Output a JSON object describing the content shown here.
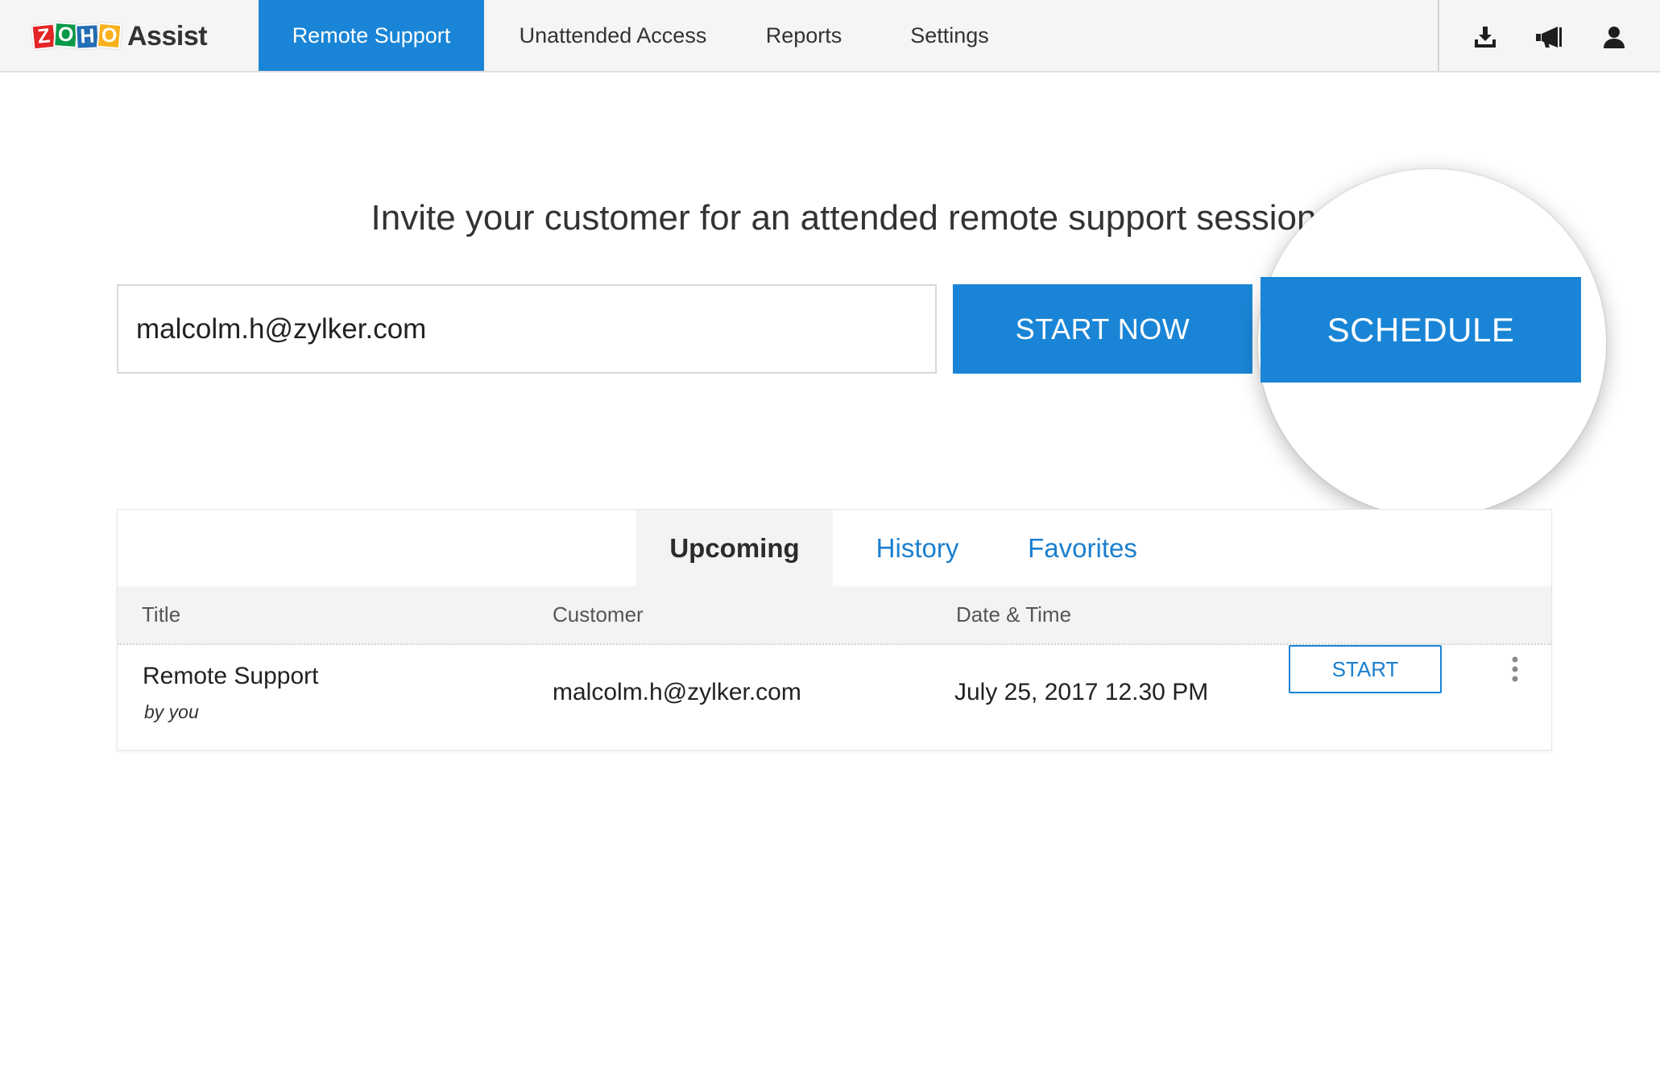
{
  "app": {
    "logo_letters": [
      "Z",
      "O",
      "H",
      "O"
    ],
    "logo_colors": [
      "#e42527",
      "#089949",
      "#226db4",
      "#f9b21d"
    ],
    "product_name": "Assist"
  },
  "nav": {
    "items": [
      {
        "label": "Remote Support",
        "active": true
      },
      {
        "label": "Unattended Access",
        "active": false
      },
      {
        "label": "Reports",
        "active": false
      },
      {
        "label": "Settings",
        "active": false
      }
    ],
    "icons": [
      "download-icon",
      "announcement-icon",
      "user-icon"
    ]
  },
  "hero": {
    "headline": "Invite your customer for an attended remote support session",
    "email_value": "malcolm.h@zylker.com",
    "start_now_label": "START NOW",
    "schedule_label": "SCHEDULE"
  },
  "sessions": {
    "tabs": [
      {
        "label": "Upcoming",
        "active": true
      },
      {
        "label": "History",
        "active": false
      },
      {
        "label": "Favorites",
        "active": false
      }
    ],
    "columns": [
      "Title",
      "Customer",
      "Date & Time"
    ],
    "rows": [
      {
        "title": "Remote Support",
        "subtitle": "by you",
        "customer": "malcolm.h@zylker.com",
        "datetime": "July 25, 2017 12.30 PM",
        "action_label": "START"
      }
    ]
  },
  "colors": {
    "accent": "#1a85d6",
    "link": "#1a7fcf",
    "topbar_bg": "#f5f5f5",
    "table_header_bg": "#f3f3f3"
  }
}
